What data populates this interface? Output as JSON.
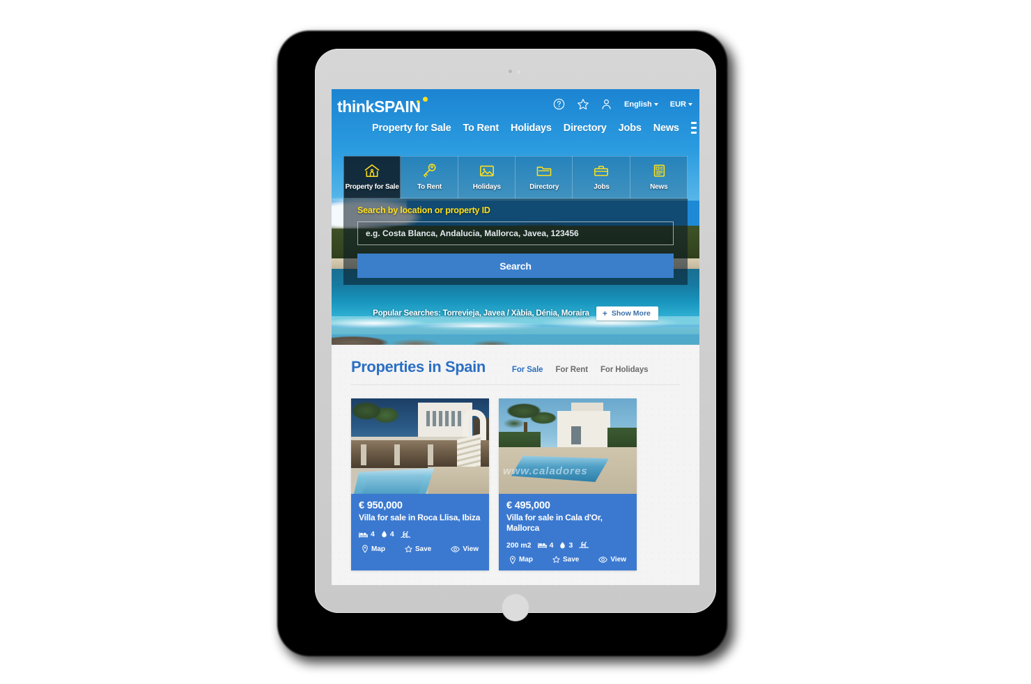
{
  "device": {
    "kind": "tablet",
    "orientation": "portrait"
  },
  "header": {
    "logo_think": "think",
    "logo_spain": "SPAIN",
    "icons": [
      "help-circle-icon",
      "star-icon",
      "user-icon"
    ],
    "language": "English",
    "currency": "EUR",
    "nav": [
      {
        "label": "Property for Sale"
      },
      {
        "label": "To Rent"
      },
      {
        "label": "Holidays"
      },
      {
        "label": "Directory"
      },
      {
        "label": "Jobs"
      },
      {
        "label": "News"
      }
    ],
    "menu_icon": "hamburger-menu-icon"
  },
  "categories": [
    {
      "label": "Property for Sale",
      "icon": "house-icon",
      "active": true
    },
    {
      "label": "To Rent",
      "icon": "key-icon",
      "active": false
    },
    {
      "label": "Holidays",
      "icon": "photo-icon",
      "active": false
    },
    {
      "label": "Directory",
      "icon": "folder-icon",
      "active": false
    },
    {
      "label": "Jobs",
      "icon": "briefcase-icon",
      "active": false
    },
    {
      "label": "News",
      "icon": "newspaper-icon",
      "active": false
    }
  ],
  "search": {
    "title": "Search by location or property ID",
    "placeholder": "e.g. Costa Blanca, Andalucia, Mallorca, Javea, 123456",
    "value": "",
    "button": "Search"
  },
  "popular": {
    "text": "Popular Searches: Torrevieja, Javea / Xàbia, Dénia, Moraira",
    "show_more": "Show More",
    "plus": "+"
  },
  "properties_section": {
    "title": "Properties in Spain",
    "tabs": [
      {
        "label": "For Sale",
        "active": true
      },
      {
        "label": "For Rent",
        "active": false
      },
      {
        "label": "For Holidays",
        "active": false
      }
    ]
  },
  "listings": [
    {
      "price": "€ 950,000",
      "title": "Villa for sale in Roca Llisa, Ibiza",
      "area": "",
      "beds": "4",
      "baths": "4",
      "pool": true,
      "actions": {
        "map": "Map",
        "save": "Save",
        "view": "View"
      }
    },
    {
      "price": "€ 495,000",
      "title": "Villa for sale in Cala d'Or, Mallorca",
      "area": "200 m2",
      "beds": "4",
      "baths": "3",
      "pool": true,
      "watermark": "www.caladores",
      "actions": {
        "map": "Map",
        "save": "Save",
        "view": "View"
      }
    }
  ],
  "colors": {
    "brand_blue": "#1e8ad6",
    "card_blue": "#3b79d0",
    "accent_yellow": "#ffe01b",
    "search_button": "#3b7fcb",
    "title_blue": "#2c6fc4",
    "page_bg": "#f4f4f4"
  }
}
